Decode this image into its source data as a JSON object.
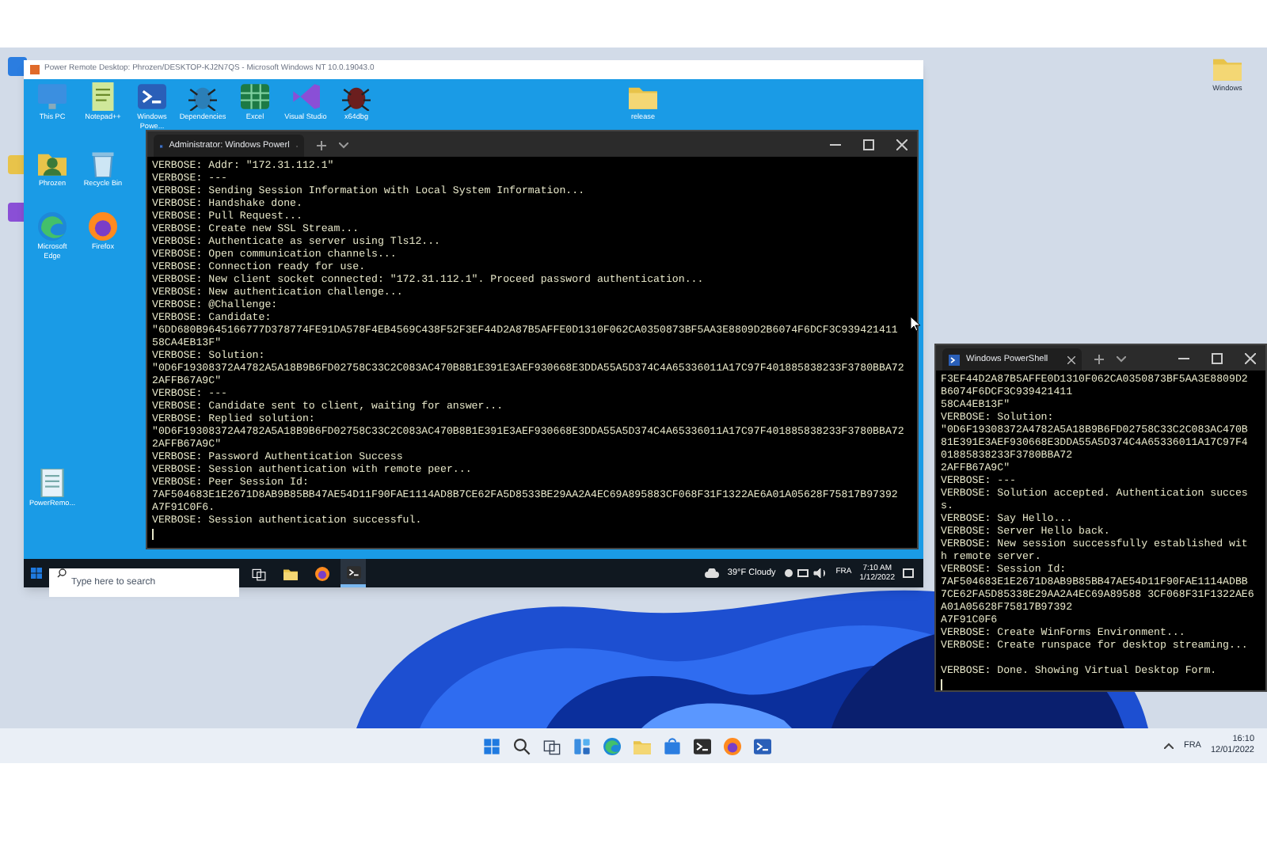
{
  "host_desktop": {
    "icons": [
      {
        "label": "Windows",
        "kind": "folder"
      }
    ]
  },
  "remote_window": {
    "title": "Power Remote Desktop: Phrozen/DESKTOP-KJ2N7QS - Microsoft Windows NT 10.0.19043.0",
    "desktop_icons": [
      {
        "label": "This PC",
        "kind": "pc"
      },
      {
        "label": "Notepad++",
        "kind": "notepad"
      },
      {
        "label": "Windows Powe...",
        "kind": "powershell"
      },
      {
        "label": "Dependencies",
        "kind": "bug"
      },
      {
        "label": "Excel",
        "kind": "excel"
      },
      {
        "label": "Visual Studio",
        "kind": "vs"
      },
      {
        "label": "x64dbg",
        "kind": "debugger"
      },
      {
        "label": "release",
        "kind": "folder"
      },
      {
        "label": "Phrozen",
        "kind": "user"
      },
      {
        "label": "Recycle Bin",
        "kind": "recycle"
      },
      {
        "label": "Microsoft Edge",
        "kind": "edge"
      },
      {
        "label": "Firefox",
        "kind": "firefox"
      },
      {
        "label": "PowerRemo...",
        "kind": "note"
      }
    ],
    "terminal": {
      "tab": "Administrator: Windows Powerl",
      "lines": [
        "VERBOSE: Addr: \"172.31.112.1\"",
        "VERBOSE: ---",
        "VERBOSE: Sending Session Information with Local System Information...",
        "VERBOSE: Handshake done.",
        "VERBOSE: Pull Request...",
        "VERBOSE: Create new SSL Stream...",
        "VERBOSE: Authenticate as server using Tls12...",
        "VERBOSE: Open communication channels...",
        "VERBOSE: Connection ready for use.",
        "VERBOSE: New client socket connected: \"172.31.112.1\". Proceed password authentication...",
        "VERBOSE: New authentication challenge...",
        "VERBOSE: @Challenge:",
        "VERBOSE: Candidate:",
        "\"6DD680B9645166777D378774FE91DA578F4EB4569C438F52F3EF44D2A87B5AFFE0D1310F062CA0350873BF5AA3E8809D2B6074F6DCF3C939421411",
        "58CA4EB13F\"",
        "VERBOSE: Solution:",
        "\"0D6F19308372A4782A5A18B9B6FD02758C33C2C083AC470B8B1E391E3AEF930668E3DDA55A5D374C4A65336011A17C97F401885838233F3780BBA72",
        "2AFFB67A9C\"",
        "VERBOSE: ---",
        "VERBOSE: Candidate sent to client, waiting for answer...",
        "VERBOSE: Replied solution:",
        "\"0D6F19308372A4782A5A18B9B6FD02758C33C2C083AC470B8B1E391E3AEF930668E3DDA55A5D374C4A65336011A17C97F401885838233F3780BBA72",
        "2AFFB67A9C\"",
        "VERBOSE: Password Authentication Success",
        "VERBOSE: Session authentication with remote peer...",
        "VERBOSE: Peer Session Id:",
        "7AF504683E1E2671D8AB9B85BB47AE54D11F90FAE1114AD8B7CE62FA5D8533BE29AA2A4EC69A895883CF068F31F1322AE6A01A05628F75817B97392",
        "A7F91C0F6.",
        "VERBOSE: Session authentication successful."
      ]
    },
    "taskbar": {
      "search_placeholder": "Type here to search",
      "apps": [
        {
          "kind": "taskview",
          "active": false
        },
        {
          "kind": "folder",
          "active": false
        },
        {
          "kind": "firefox",
          "active": false
        },
        {
          "kind": "terminal",
          "active": true
        }
      ],
      "weather": "39°F Cloudy",
      "language": "FRA",
      "time": "7:10 AM",
      "date": "1/12/2022"
    }
  },
  "side_terminal": {
    "tab": "Windows PowerShell",
    "lines": [
      "F3EF44D2A87B5AFFE0D1310F062CA0350873BF5AA3E8809D2",
      "B6074F6DCF3C939421411",
      "58CA4EB13F\"",
      "VERBOSE: Solution:",
      "\"0D6F19308372A4782A5A18B9B6FD02758C33C2C083AC470B",
      "81E391E3AEF930668E3DDA55A5D374C4A65336011A17C97F4",
      "01885838233F3780BBA72",
      "2AFFB67A9C\"",
      "VERBOSE: ---",
      "VERBOSE: Solution accepted. Authentication succes",
      "s.",
      "VERBOSE: Say Hello...",
      "VERBOSE: Server Hello back.",
      "VERBOSE: New session successfully established wit",
      "h remote server.",
      "VERBOSE: Session Id:",
      "7AF504683E1E2671D8AB9B85BB47AE54D11F90FAE1114ADBB",
      "7CE62FA5D85338E29AA2A4EC69A89588 3CF068F31F1322AE6",
      "A01A05628F75817B97392",
      "A7F91C0F6",
      "VERBOSE: Create WinForms Environment...",
      "VERBOSE: Create runspace for desktop streaming..."
    ],
    "final_line": "VERBOSE: Done. Showing Virtual Desktop Form."
  },
  "host_taskbar": {
    "apps": [
      {
        "kind": "start"
      },
      {
        "kind": "search"
      },
      {
        "kind": "taskview"
      },
      {
        "kind": "widgets"
      },
      {
        "kind": "edge"
      },
      {
        "kind": "folder"
      },
      {
        "kind": "store"
      },
      {
        "kind": "terminal"
      },
      {
        "kind": "firefox"
      },
      {
        "kind": "powershell"
      }
    ],
    "language": "FRA",
    "time": "16:10",
    "date": "12/01/2022"
  }
}
